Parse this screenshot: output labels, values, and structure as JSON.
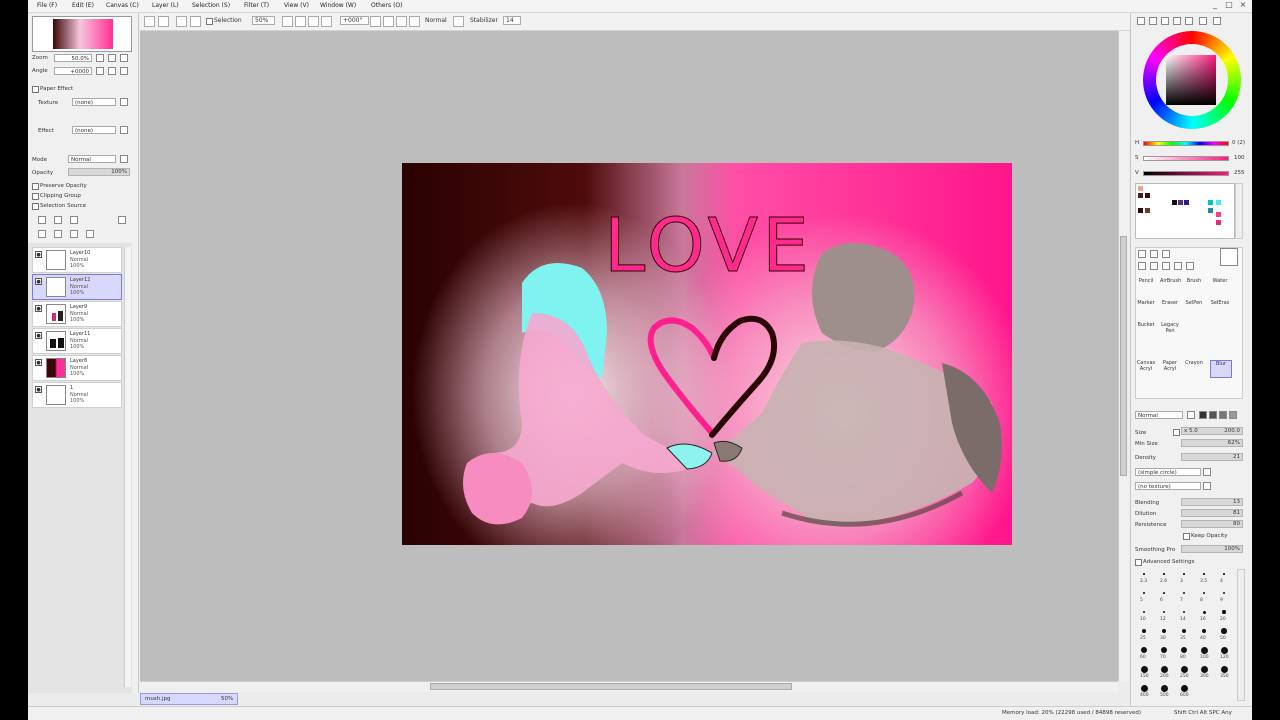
{
  "menubar": {
    "items": [
      "File (F)",
      "Edit (E)",
      "Canvas (C)",
      "Layer (L)",
      "Selection (S)",
      "Filter (T)",
      "View (V)",
      "Window (W)",
      "Others (O)"
    ],
    "window_controls": [
      "_",
      "□",
      "×"
    ]
  },
  "toolbar": {
    "selection_label": "Selection",
    "zoom": "50%",
    "rotation": "+000°",
    "blend_mode": "Normal",
    "stabilizer_label": "Stabilizer",
    "stabilizer_value": "14"
  },
  "navigator": {
    "zoom_label": "Zoom",
    "zoom_value": "50.0%",
    "angle_label": "Angle",
    "angle_value": "+0000"
  },
  "paper_effect": {
    "title": "Paper Effect",
    "texture_label": "Texture",
    "texture_value": "(none)",
    "effect_label": "Effect",
    "effect_value": "(none)"
  },
  "layer_props": {
    "mode_label": "Mode",
    "mode_value": "Normal",
    "opacity_label": "Opacity",
    "opacity_value": "100%",
    "options": [
      "Preserve Opacity",
      "Clipping Group",
      "Selection Source"
    ]
  },
  "layers": [
    {
      "name": "Layer10",
      "mode": "Normal",
      "opacity": "100%",
      "thumb": "#ffffff"
    },
    {
      "name": "Layer12",
      "mode": "Normal",
      "opacity": "100%",
      "thumb": "#ffffff",
      "selected": true
    },
    {
      "name": "Layer9",
      "mode": "Normal",
      "opacity": "100%",
      "thumb": "#f0f0f0"
    },
    {
      "name": "Layer11",
      "mode": "Normal",
      "opacity": "100%",
      "thumb": "#f4f4f4"
    },
    {
      "name": "Layer8",
      "mode": "Normal",
      "opacity": "100%",
      "thumb": "#e0307a"
    },
    {
      "name": "1",
      "mode": "Normal",
      "opacity": "100%",
      "thumb": "#ffffff"
    }
  ],
  "artwork": {
    "text": "LOVE",
    "colors": {
      "left": "#2c0303",
      "mid": "#f8b8d8",
      "right": "#ff1e8e",
      "cyan": "#7ff3f0",
      "pink": "#f07ab8",
      "gray": "#8e7f7b"
    }
  },
  "color_panel": {
    "h_label": "H",
    "h_value": "0 (2)",
    "s_label": "S",
    "s_value": "100",
    "v_label": "V",
    "v_value": "255"
  },
  "tools": {
    "rows": [
      [
        "Pencil",
        "AirBrush",
        "Brush",
        "Water"
      ],
      [
        "Marker",
        "Eraser",
        "SelPen",
        "SelEras"
      ],
      [
        "Bucket",
        "Legacy Pen"
      ],
      [
        "Canvas Acryl",
        "Paper Acryl",
        "Crayon",
        "Blur"
      ]
    ]
  },
  "brush_settings": {
    "blend_mode": "Normal",
    "size_label": "Size",
    "size_mult": "x 5.0",
    "size_value": "200.0",
    "minsize_label": "Min Size",
    "minsize_value": "62%",
    "density_label": "Density",
    "density_value": "21",
    "shape": "(simple circle)",
    "texture": "(no texture)",
    "blending_label": "Blending",
    "blending_value": "13",
    "dilution_label": "Dilution",
    "dilution_value": "81",
    "persistence_label": "Persistence",
    "persistence_value": "80",
    "keep_opacity": "Keep Opacity",
    "smoothing_label": "Smoothing Pro",
    "smoothing_value": "100%",
    "advanced": "Advanced Settings"
  },
  "brush_sizes": [
    "2.3",
    "2.6",
    "3",
    "3.5",
    "4",
    "5",
    "6",
    "7",
    "8",
    "9",
    "10",
    "12",
    "14",
    "16",
    "20",
    "25",
    "30",
    "35",
    "40",
    "50",
    "60",
    "70",
    "80",
    "100",
    "120",
    "150",
    "200",
    "250",
    "300",
    "350",
    "400",
    "500",
    "600"
  ],
  "status": {
    "tab_name": "mush.jpg",
    "tab_zoom": "50%",
    "memory": "Memory load: 20% (22298 used / 84898 reserved)",
    "keys": "Shift Ctrl Alt SPC Any"
  }
}
